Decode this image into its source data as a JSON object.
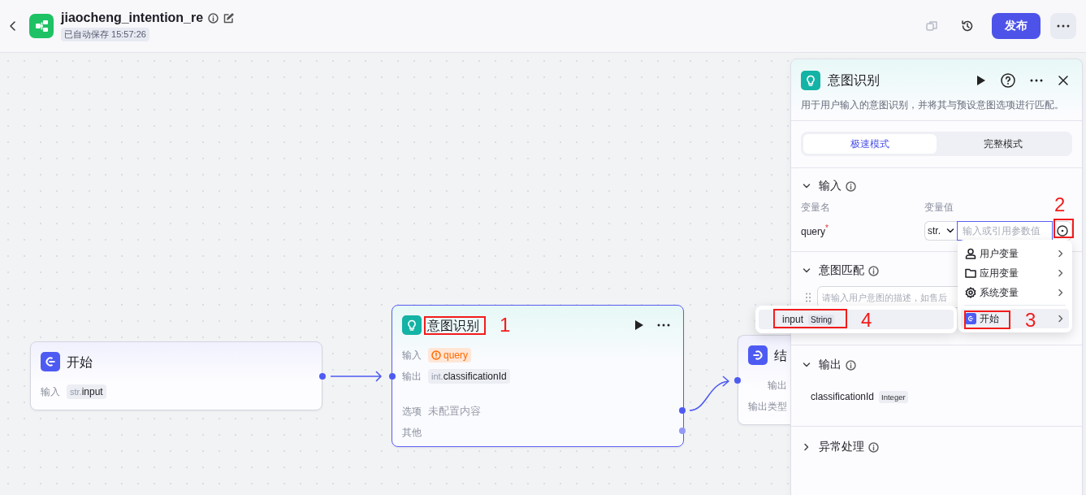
{
  "header": {
    "title": "jiaocheng_intention_re",
    "autosave": "已自动保存 15:57:26",
    "copy_disabled": true,
    "publish_button": "发布"
  },
  "canvas": {
    "nodes": [
      {
        "kind": "start",
        "title": "开始",
        "selected": false,
        "rows": [
          {
            "label": "输入",
            "type": "str.",
            "value": "input"
          }
        ]
      },
      {
        "kind": "intent",
        "title": "意图识别",
        "annotation": "1",
        "selected": true,
        "rows": [
          {
            "label": "输入",
            "value": "query",
            "warning": true
          },
          {
            "label": "输出",
            "type": "int.",
            "value": "classificationId"
          },
          {
            "label": "选项",
            "placeholder": "未配置内容"
          },
          {
            "label": "其他"
          }
        ]
      },
      {
        "kind": "end",
        "title": "结",
        "selected": false,
        "rows": [
          {
            "label": "输出"
          },
          {
            "label": "输出类型"
          }
        ]
      }
    ]
  },
  "panel": {
    "title": "意图识别",
    "description": "用于用户输入的意图识别，并将其与预设意图选项进行匹配。",
    "modes": [
      {
        "label": "极速模式",
        "selected": true
      },
      {
        "label": "完整模式",
        "selected": false
      }
    ],
    "sections": [
      {
        "kind": "inputs",
        "title": "输入",
        "expanded": true,
        "column_1": "变量名",
        "column_2": "变量值",
        "params": [
          {
            "name": "query",
            "required_mark": "*",
            "type": "str.",
            "placeholder": "输入或引用参数值"
          }
        ]
      },
      {
        "kind": "intents",
        "title": "意图匹配",
        "expanded": true,
        "placeholder": "请输入用户意图的描述，如售后"
      },
      {
        "kind": "outputs",
        "title": "输出",
        "expanded": true,
        "outputs": [
          {
            "name": "classificationId",
            "type": "Integer"
          }
        ]
      },
      {
        "kind": "error",
        "title": "异常处理",
        "expanded": false
      }
    ]
  },
  "variable_menu": {
    "items": [
      {
        "kind": "user",
        "label": "用户变量",
        "selected": false
      },
      {
        "kind": "app",
        "label": "应用变量",
        "selected": false
      },
      {
        "kind": "system",
        "label": "系统变量",
        "selected": false
      },
      {
        "kind": "node",
        "label": "开始",
        "selected": true
      }
    ]
  },
  "submenu": {
    "items": [
      {
        "name": "input",
        "type": "String",
        "selected": true
      }
    ]
  },
  "annotations": [
    {
      "number": "2"
    },
    {
      "number": "4"
    },
    {
      "number": "3"
    }
  ]
}
